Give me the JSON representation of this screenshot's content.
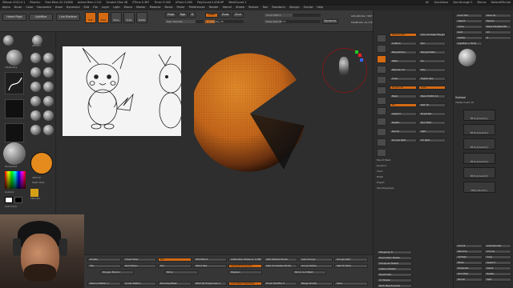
{
  "titlebar": {
    "app": "ZBrush 2022.0.1",
    "items": [
      "Pikachu",
      "Free Mem 22.244GB",
      "Active Mem 1110",
      "Scratch Disk 48",
      "ZTime 0.367",
      "Timer 0.000",
      "ATime 0.005",
      "PolyCount 0.458 KP",
      "MeshCount 1"
    ],
    "right": [
      "AC",
      "QuickSave",
      "See-through 0",
      "Menus",
      "DefaultZScript"
    ]
  },
  "menubar": [
    "Alpha",
    "Brush",
    "Color",
    "Document",
    "Draw",
    "Dynamics",
    "Edit",
    "File",
    "Layer",
    "Light",
    "Macro",
    "Marker",
    "Material",
    "Movie",
    "Picker",
    "Preferences",
    "Render",
    "Stencil",
    "Stroke",
    "Texture",
    "Tool",
    "Transform",
    "Zplugin",
    "Zscript",
    "Help"
  ],
  "topshelf": {
    "home": "Home Page",
    "lightbox": "LightBox",
    "live": "Live Boolean",
    "edit": "Edit",
    "draw": "Draw",
    "move": "Move",
    "scale": "Scale",
    "rotate": "Rotate",
    "mrgb": "Mrgb",
    "rgb": "Rgb",
    "m": "M",
    "rgb_intensity": "Rgb Intensity",
    "zadd": "Zadd",
    "zsub": "Zsub",
    "zcut": "Zcut",
    "z_intensity": "Z Intensity 25",
    "focal_shift": "Focal Shift 0",
    "draw_size": "Draw Size 28.75",
    "dynamic": "Dynamic",
    "active_points": "ActivePoints: 7,807",
    "total_points": "TotalPoints: 41,179"
  },
  "lefttray": {
    "brushes": [
      "Standard",
      "ZProject",
      "ClayBuildup",
      "Move",
      "Pinch",
      "DamStandard",
      "TrimDynamic",
      "hPolish",
      "BrushAlpha",
      "Smooth",
      "Dots",
      "Gradient",
      "Off",
      "Alpha Off",
      "Texture Off",
      "SkinShade4"
    ],
    "switch_color": "SwitchColor",
    "alternate": "Alternate",
    "gradient": "Gradient",
    "fill_object": "FillObject",
    "inflat": "Inflat 20",
    "depth_mask": "Depth Mask"
  },
  "rightpanel": {
    "subtool_title": "Subtool",
    "visible_count": "Visible Count 10",
    "items": [
      "Load Tool",
      "Save As",
      "Import",
      "Export",
      "Clone",
      "Make PolyMesh3D",
      "GoZ",
      "All",
      "Visible",
      "R",
      "Lightbox > Tools",
      "PM3D_Sphere3D_1",
      "Edit",
      "Lazy Mouse"
    ],
    "zplugin": [
      "Polygroup It",
      "Decimation Master",
      "Transpose Master",
      "Subtool Master",
      "Deactivate",
      "UV Master",
      "Multi Map Exporter"
    ],
    "mid": [
      "PolyGroupIt",
      "Use and Keep Polygroups",
      "Custom",
      "Del",
      "MergeDown",
      "MergeVisible",
      "Weld",
      "Uv",
      "Remesh All",
      "Poly",
      "Inner",
      "Higher Res",
      "Project All",
      "Color",
      "Mask",
      "Mesh Width 0.0",
      "Fill",
      "Dist 10",
      "Append",
      "Duplicate",
      "Delete",
      "Del Other",
      "Del All",
      "Split",
      "Groups Split",
      "UV Split"
    ],
    "export": [
      "Export Mesh",
      "Dynamic",
      "Thick",
      "Polish",
      "Project",
      "Use Polygroups"
    ],
    "subtools": [
      "PM3D_Sphere3D_1",
      "PM3D_Sphere3D_2",
      "PM3D_Sphere3D_3",
      "PM3D_Sphere3D_4",
      "PM3D_Sphere3D_5",
      "PM3D_Plane3D_1"
    ],
    "bottom": [
      "List All",
      "Auto Reorder",
      "Rename",
      "All Low",
      "All High",
      "Copy",
      "Paste",
      "Append",
      "Duplicate",
      "Insert",
      "Del Other",
      "Delete",
      "Del All",
      "Split"
    ]
  },
  "bottomshelf": {
    "row1": [
      "Double",
      "Close Holes",
      "Dul",
      "WorldPoint",
      "Calibration Distance: 0.00022",
      "Split Masked Points",
      "Auto Groups",
      "Groups Split"
    ],
    "row2": [
      "Flip",
      "Del Hidden",
      "Del",
      "World Rad",
      "Spotlight Projection",
      "Split Unmasked Points",
      "Group Visible",
      "Split To Parts"
    ],
    "row3": [
      "Polygon Mode 1",
      "Mirror",
      "Sharpen",
      "Mirror And Weld"
    ],
    "row4": [
      "Reduce Pattern 1",
      "Linear Pattern",
      "BoundaryMask",
      "Mask By Polygroups 0",
      "Auto Mask FiberMesh",
      "Brush Modifier 0",
      "Merge Similar",
      "Save"
    ]
  },
  "colors": {
    "accent": "#d46a13",
    "body": "#c9731a"
  }
}
